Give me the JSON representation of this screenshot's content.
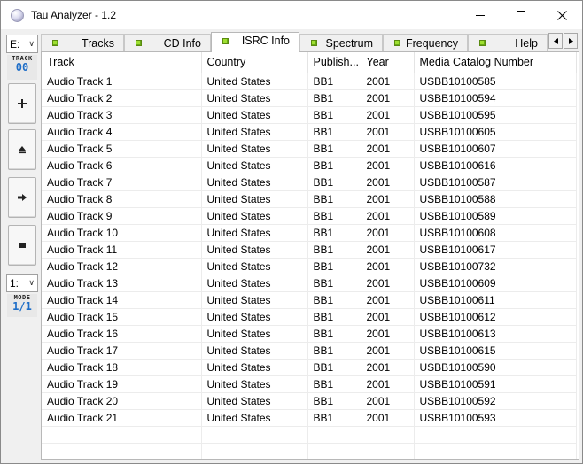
{
  "window": {
    "title": "Tau Analyzer - 1.2"
  },
  "left_panel": {
    "drive": "E:",
    "track_label": "TRACK",
    "track_value": "00",
    "speed": "1:",
    "mode_label": "MODE",
    "mode_value": "1/1",
    "buttons": [
      "add-icon",
      "eject-icon",
      "next-icon",
      "stop-icon"
    ]
  },
  "tabs": [
    {
      "label": "Tracks"
    },
    {
      "label": "CD Info"
    },
    {
      "label": "ISRC Info",
      "active": true
    },
    {
      "label": "Spectrum"
    },
    {
      "label": "Frequency"
    },
    {
      "label": "Help"
    }
  ],
  "tab_led_color": "#9ee030",
  "table": {
    "headers": [
      "Track",
      "Country",
      "Publish...",
      "Year",
      "Media Catalog Number"
    ],
    "rows": [
      [
        "Audio Track 1",
        "United States",
        "BB1",
        "2001",
        "USBB10100585"
      ],
      [
        "Audio Track 2",
        "United States",
        "BB1",
        "2001",
        "USBB10100594"
      ],
      [
        "Audio Track 3",
        "United States",
        "BB1",
        "2001",
        "USBB10100595"
      ],
      [
        "Audio Track 4",
        "United States",
        "BB1",
        "2001",
        "USBB10100605"
      ],
      [
        "Audio Track 5",
        "United States",
        "BB1",
        "2001",
        "USBB10100607"
      ],
      [
        "Audio Track 6",
        "United States",
        "BB1",
        "2001",
        "USBB10100616"
      ],
      [
        "Audio Track 7",
        "United States",
        "BB1",
        "2001",
        "USBB10100587"
      ],
      [
        "Audio Track 8",
        "United States",
        "BB1",
        "2001",
        "USBB10100588"
      ],
      [
        "Audio Track 9",
        "United States",
        "BB1",
        "2001",
        "USBB10100589"
      ],
      [
        "Audio Track 10",
        "United States",
        "BB1",
        "2001",
        "USBB10100608"
      ],
      [
        "Audio Track 11",
        "United States",
        "BB1",
        "2001",
        "USBB10100617"
      ],
      [
        "Audio Track 12",
        "United States",
        "BB1",
        "2001",
        "USBB10100732"
      ],
      [
        "Audio Track 13",
        "United States",
        "BB1",
        "2001",
        "USBB10100609"
      ],
      [
        "Audio Track 14",
        "United States",
        "BB1",
        "2001",
        "USBB10100611"
      ],
      [
        "Audio Track 15",
        "United States",
        "BB1",
        "2001",
        "USBB10100612"
      ],
      [
        "Audio Track 16",
        "United States",
        "BB1",
        "2001",
        "USBB10100613"
      ],
      [
        "Audio Track 17",
        "United States",
        "BB1",
        "2001",
        "USBB10100615"
      ],
      [
        "Audio Track 18",
        "United States",
        "BB1",
        "2001",
        "USBB10100590"
      ],
      [
        "Audio Track 19",
        "United States",
        "BB1",
        "2001",
        "USBB10100591"
      ],
      [
        "Audio Track 20",
        "United States",
        "BB1",
        "2001",
        "USBB10100592"
      ],
      [
        "Audio Track 21",
        "United States",
        "BB1",
        "2001",
        "USBB10100593"
      ]
    ]
  }
}
